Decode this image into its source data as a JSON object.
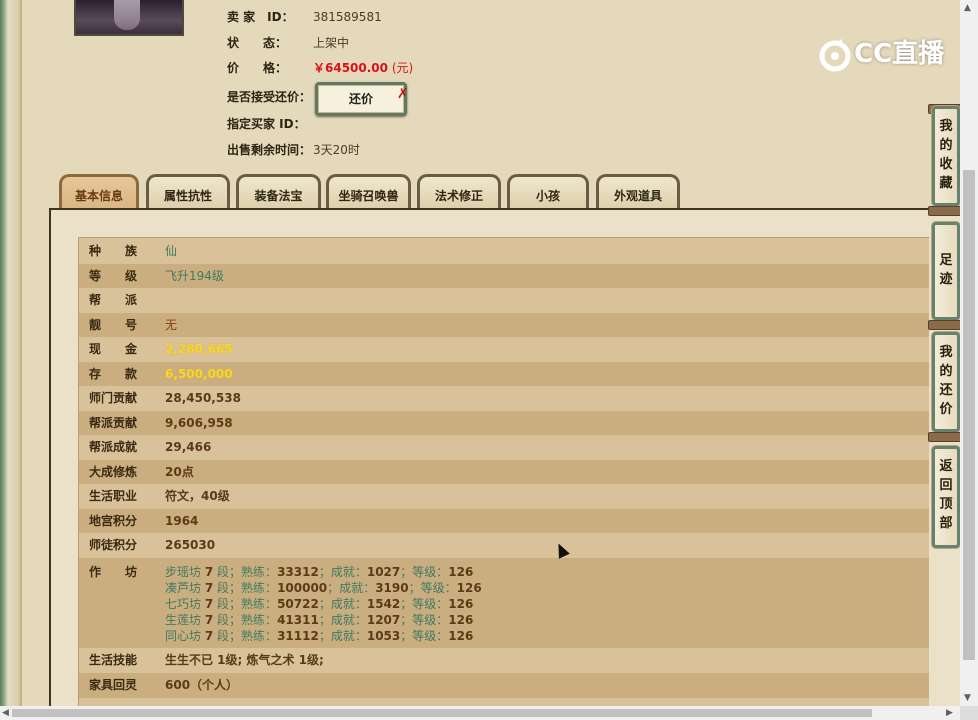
{
  "seller": {
    "id_label": "卖 家　ID：",
    "id_value": "381589581",
    "status_label": "状　　态：",
    "status_value": "上架中",
    "price_label": "价　　格：",
    "price_value": "￥64500.00",
    "price_unit": "(元)",
    "accept_offer_label": "是否接受还价：",
    "offer_button": "还价",
    "offer_mark": "✗",
    "buyer_id_label": "指定买家 ID：",
    "buyer_id_value": "",
    "remaining_label": "出售剩余时间：",
    "remaining_value": "3天20时"
  },
  "logo": {
    "text": "CC直播"
  },
  "tabs": [
    {
      "label": "基本信息",
      "active": true
    },
    {
      "label": "属性抗性"
    },
    {
      "label": "装备法宝"
    },
    {
      "label": "坐骑召唤兽"
    },
    {
      "label": "法术修正"
    },
    {
      "label": "小孩"
    },
    {
      "label": "外观道具"
    }
  ],
  "attributes": [
    {
      "label": "种　　族",
      "value": "仙"
    },
    {
      "label": "等　　级",
      "value": "飞升194级"
    },
    {
      "label": "帮　　派",
      "value": ""
    },
    {
      "label": "靓　　号",
      "value": "无"
    },
    {
      "label": "现　　金",
      "value": "2,280,665"
    },
    {
      "label": "存　　款",
      "value": "6,500,000"
    },
    {
      "label": "师门贡献",
      "value": "28,450,538"
    },
    {
      "label": "帮派贡献",
      "value": "9,606,958"
    },
    {
      "label": "帮派成就",
      "value": "29,466"
    },
    {
      "label": "大成修炼",
      "value": "20点"
    },
    {
      "label": "生活职业",
      "value": "符文，40级"
    },
    {
      "label": "地宫积分",
      "value": "1964"
    },
    {
      "label": "师徒积分",
      "value": "265030"
    },
    {
      "label": "作　　坊",
      "value": ""
    },
    {
      "label": "生活技能",
      "value": "生生不已 1级; 炼气之术 1级;"
    },
    {
      "label": "家具回灵",
      "value": "600（个人）"
    }
  ],
  "workshops": [
    {
      "name": "步瑶坊",
      "level": "7",
      "skill": "33312",
      "achieve": "1027",
      "grade": "126"
    },
    {
      "name": "凑芦坊",
      "level": "7",
      "skill": "100000",
      "achieve": "3190",
      "grade": "126"
    },
    {
      "name": "七巧坊",
      "level": "7",
      "skill": "50722",
      "achieve": "1542",
      "grade": "126"
    },
    {
      "name": "生莲坊",
      "level": "7",
      "skill": "41311",
      "achieve": "1207",
      "grade": "126"
    },
    {
      "name": "同心坊",
      "level": "7",
      "skill": "31112",
      "achieve": "1053",
      "grade": "126"
    }
  ],
  "workshop_words": {
    "level_unit": "段；",
    "skill": "熟练：",
    "achieve": "成就：",
    "grade": "等级："
  },
  "sidebar": [
    {
      "label": "我的收藏",
      "chars": [
        "我",
        "的",
        "收",
        "藏"
      ]
    },
    {
      "label": "足迹",
      "chars": [
        "足",
        "迹"
      ]
    },
    {
      "label": "我的还价",
      "chars": [
        "我",
        "的",
        "还",
        "价"
      ]
    },
    {
      "label": "返回顶部",
      "chars": [
        "返",
        "回",
        "顶",
        "部"
      ]
    }
  ]
}
